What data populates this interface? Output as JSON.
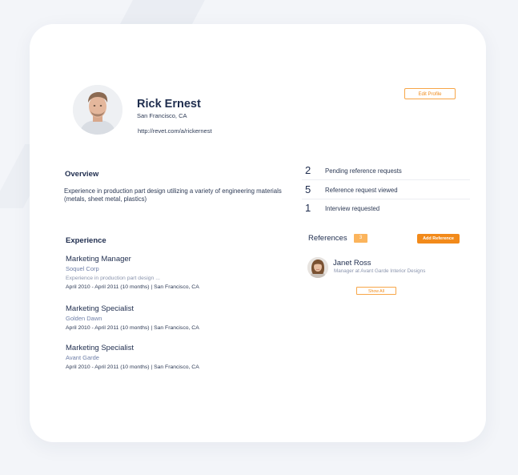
{
  "profile": {
    "name": "Rick Ernest",
    "location": "San Francisco, CA",
    "url": "http://revet.com/a/rickernest",
    "edit_label": "Edit Profile"
  },
  "overview": {
    "title": "Overview",
    "text": "Experience in production part design utilizing a variety of engineering materials (metals, sheet metal, plastics)"
  },
  "stats": [
    {
      "value": "2",
      "label": "Pending reference requests"
    },
    {
      "value": "5",
      "label": "Reference request viewed"
    },
    {
      "value": "1",
      "label": "Interview requested"
    }
  ],
  "experience": {
    "title": "Experience",
    "jobs": [
      {
        "title": "Marketing Manager",
        "company": "Soquel Corp",
        "description": "Experience in production part design ...",
        "dates": "April 2010 - April 2011 (10 months) | San Francisco, CA"
      },
      {
        "title": "Marketing Specialist",
        "company": "Golden Dawn",
        "dates": "April 2010 - April 2011 (10 months) | San Francisco, CA"
      },
      {
        "title": "Marketing Specialist",
        "company": "Avant Garde",
        "dates": "April 2010 - April 2011 (10 months) | San Francisco, CA"
      }
    ]
  },
  "references": {
    "title": "References",
    "count": "3",
    "add_label": "Add Reference",
    "items": [
      {
        "name": "Janet Ross",
        "role": "Manager at Avant Garde Interior Designs"
      }
    ],
    "show_all_label": "Show All"
  },
  "colors": {
    "accent": "#f28a1a",
    "accent_light": "#fbb45c",
    "text_primary": "#1f2d4e",
    "text_muted": "#8a94ad",
    "company": "#6f7fa8",
    "background": "#f3f5f9"
  },
  "icons": {
    "profile_avatar": "user-photo-avatar",
    "reference_avatar": "reference-photo-avatar"
  }
}
